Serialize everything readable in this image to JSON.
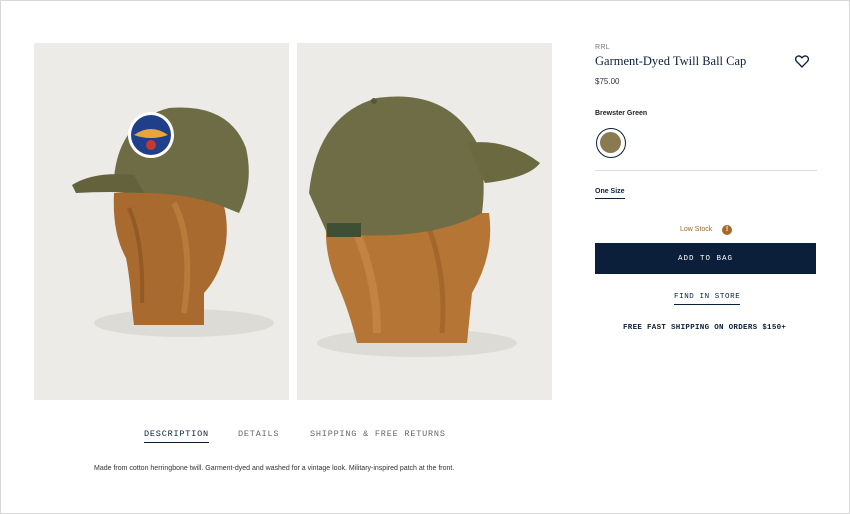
{
  "gallery": {
    "images": [
      {
        "alt": "front-view"
      },
      {
        "alt": "back-view"
      }
    ]
  },
  "product": {
    "brand": "RRL",
    "title": "Garment-Dyed Twill Ball Cap",
    "price": "$75.00",
    "color_label": "Brewster Green",
    "swatch_color": "#8a7a52",
    "size": "One Size",
    "stock_text": "Low Stock",
    "stock_icon": "!",
    "add_to_bag": "ADD TO BAG",
    "find_in_store": "FIND IN STORE",
    "shipping_note": "FREE FAST SHIPPING ON ORDERS $150+"
  },
  "tabs": [
    {
      "label": "DESCRIPTION",
      "active": true
    },
    {
      "label": "DETAILS",
      "active": false
    },
    {
      "label": "SHIPPING & FREE RETURNS",
      "active": false
    }
  ],
  "description": "Made from cotton herringbone twill. Garment-dyed and washed for a vintage look. Military-inspired patch at the front.",
  "colors": {
    "navy": "#0b1f3a",
    "low_stock": "#a56a25",
    "image_bg": "#ecebe8"
  }
}
